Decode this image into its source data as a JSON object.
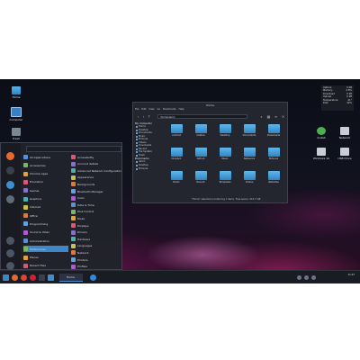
{
  "desktop": {
    "icons": [
      {
        "label": "Home",
        "kind": "folder"
      },
      {
        "label": "Computer",
        "kind": "monitor"
      },
      {
        "label": "Trash",
        "kind": "trash"
      }
    ],
    "right_icons": [
      {
        "label": "Install",
        "kind": "green"
      },
      {
        "label": "Network",
        "kind": "drive"
      },
      {
        "label": "Windows 10",
        "kind": "drive"
      },
      {
        "label": "USB Drive",
        "kind": "drive"
      }
    ]
  },
  "conky": {
    "rows": [
      {
        "k": "Uptime",
        "v": "0:08"
      },
      {
        "k": "Memory",
        "v": "2.8%"
      },
      {
        "k": "Download",
        "v": "0 kB"
      },
      {
        "k": "Upload",
        "v": "0 kB"
      },
      {
        "k": "Temperature",
        "v": "41°"
      },
      {
        "k": "Disk",
        "v": "42%"
      }
    ]
  },
  "menu": {
    "search_placeholder": "",
    "left": [
      "All Applications",
      "Accessories",
      "Chrome Apps",
      "Education",
      "Games",
      "Graphics",
      "Internet",
      "Office",
      "Programming",
      "Sound & Video",
      "Administration",
      "Preferences",
      "Places",
      "Recent Files"
    ],
    "right": [
      "Accessibility",
      "Account details",
      "Advanced Network Configuration",
      "Appearance",
      "Backgrounds",
      "Bluetooth Manager",
      "Color",
      "Date & Time",
      "Disk Control",
      "Disks",
      "Displays",
      "Drivers",
      "Hardware",
      "Languages",
      "Network",
      "Printers",
      "Profiles"
    ],
    "selected_left": "Preferences"
  },
  "file_manager": {
    "title": "Home",
    "menus": [
      "File",
      "Edit",
      "View",
      "Go",
      "Bookmarks",
      "Help"
    ],
    "path": "/home/demo",
    "sidebar": {
      "my_computer": "My Computer",
      "places": [
        "Home",
        "Desktop",
        "Documents",
        "Music",
        "Pictures",
        "Videos",
        "Downloads",
        "Recent",
        "File System",
        "Trash"
      ],
      "bookmarks": "Bookmarks",
      "bookmark_items": [
        "demo",
        "Desktop",
        "Pictures"
      ]
    },
    "folders": [
      "Android",
      "Calibre",
      "Desktop",
      "Documents",
      "Downloads",
      "Dropbox",
      "Github",
      "Music",
      "Networks",
      "Pictures",
      "Public",
      "Recent",
      "Templates",
      "Videos",
      "Websites"
    ],
    "status": "\"Home\" selected (containing 1 item), Free space: 215.7 GB"
  },
  "taskbar": {
    "window_label": "Home",
    "time": "11:27",
    "date": ""
  }
}
